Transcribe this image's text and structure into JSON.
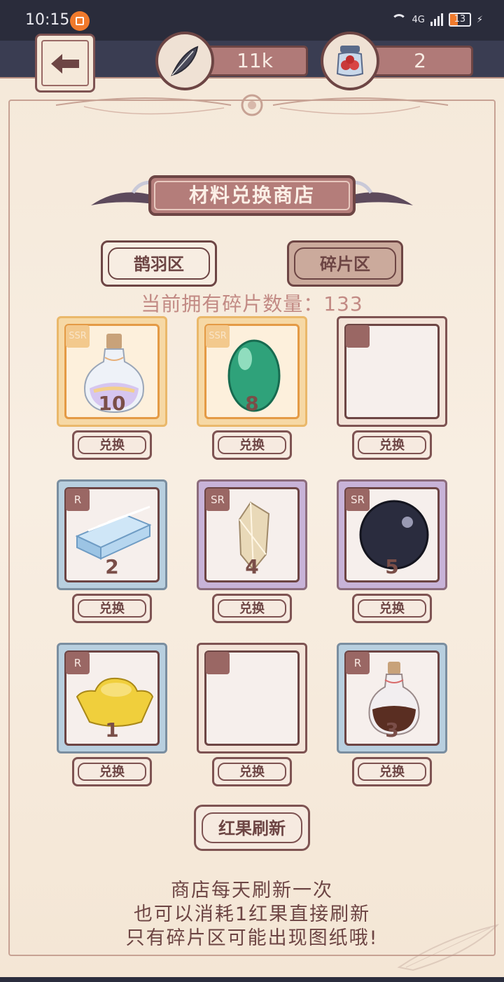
{
  "status_bar": {
    "time": "10:15",
    "network": "4G",
    "battery": "13"
  },
  "header": {
    "feather_amount": "11k",
    "berry_amount": "2"
  },
  "title": "材料兑换商店",
  "tabs": [
    {
      "label": "鹊羽区",
      "active": false
    },
    {
      "label": "碎片区",
      "active": true
    }
  ],
  "fragment_count": {
    "label": "当前拥有碎片数量：",
    "value": "133"
  },
  "items": [
    {
      "rarity": "SSR",
      "qty": "10",
      "icon": "rainbow-potion-bottle-icon",
      "button": "兑换"
    },
    {
      "rarity": "SSR",
      "qty": "8",
      "icon": "green-gem-icon",
      "button": "兑换"
    },
    {
      "rarity": "",
      "qty": "",
      "icon": "empty-slot",
      "button": "兑换"
    },
    {
      "rarity": "R",
      "qty": "2",
      "icon": "blue-cloth-icon",
      "button": "兑换"
    },
    {
      "rarity": "SR",
      "qty": "4",
      "icon": "crystal-shard-icon",
      "button": "兑换"
    },
    {
      "rarity": "SR",
      "qty": "5",
      "icon": "dark-orb-icon",
      "button": "兑换"
    },
    {
      "rarity": "R",
      "qty": "1",
      "icon": "gold-ingot-icon",
      "button": "兑换"
    },
    {
      "rarity": "",
      "qty": "",
      "icon": "empty-slot",
      "button": "兑换"
    },
    {
      "rarity": "R",
      "qty": "3",
      "icon": "brown-potion-bottle-icon",
      "button": "兑换"
    }
  ],
  "refresh_button": "红果刷新",
  "notes": [
    "商店每天刷新一次",
    "也可以消耗1红果直接刷新",
    "只有碎片区可能出现图纸哦!"
  ]
}
